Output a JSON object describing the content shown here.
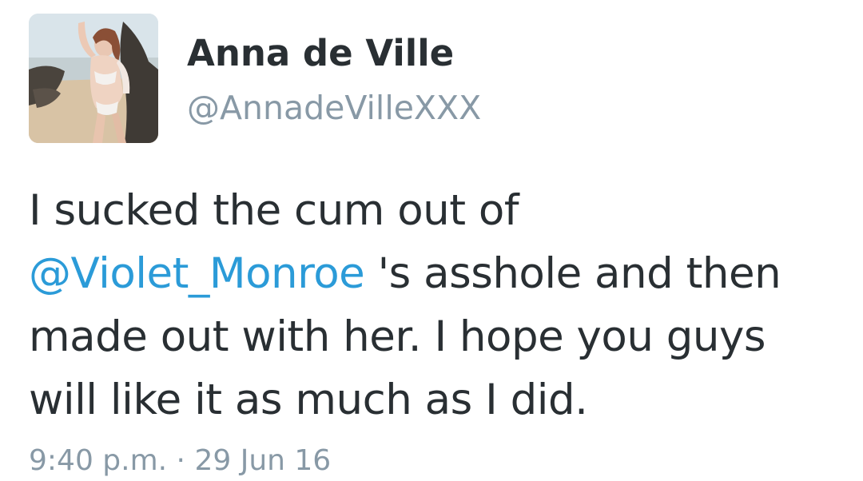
{
  "author": {
    "display_name": "Anna de Ville",
    "handle": "@AnnadeVilleXXX",
    "avatar": "profile-photo"
  },
  "tweet": {
    "text_before_mention": "I sucked the cum out of ",
    "mention": "@Violet_Monroe",
    "text_after_mention": " 's asshole and then made out with her. I hope you guys will like it as much as I did."
  },
  "meta": {
    "time": "9:40 p.m.",
    "separator": "·",
    "date": "29 Jun 16"
  },
  "colors": {
    "text": "#292f33",
    "secondary": "#8899a6",
    "link": "#2b9bd8",
    "background": "#ffffff"
  }
}
